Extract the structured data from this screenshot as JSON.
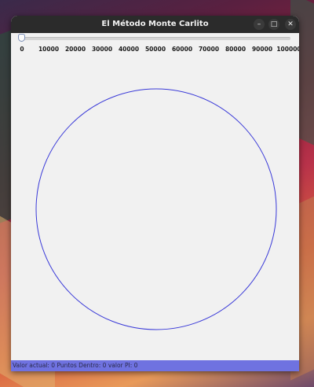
{
  "window": {
    "title": "El Método Monte Carlito",
    "minimize_glyph": "–",
    "maximize_glyph": "□",
    "close_glyph": "✕"
  },
  "slider": {
    "value": 0,
    "min": 0,
    "max": 100000,
    "tick_labels": [
      "0",
      "10000",
      "20000",
      "30000",
      "40000",
      "50000",
      "60000",
      "70000",
      "80000",
      "90000",
      "100000"
    ]
  },
  "canvas": {
    "circle_color": "#3a3ad8",
    "background": "#f1f1f1"
  },
  "status": {
    "text": "Valor actual: 0 Puntos Dentro: 0 valor PI: 0",
    "bar_color": "#6f72e0"
  }
}
